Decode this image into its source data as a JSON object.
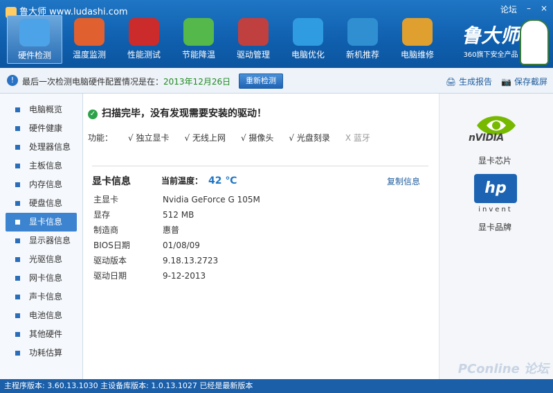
{
  "app": {
    "title": "鲁大师 www.ludashi.com",
    "forum": "论坛"
  },
  "window": {
    "minimize": "–",
    "close": "×"
  },
  "toolbar": [
    {
      "label": "硬件检测",
      "active": true,
      "color": "#4da3e8"
    },
    {
      "label": "温度监测",
      "active": false,
      "color": "#e06030"
    },
    {
      "label": "性能测试",
      "active": false,
      "color": "#cc2b2b"
    },
    {
      "label": "节能降温",
      "active": false,
      "color": "#55b84a"
    },
    {
      "label": "驱动管理",
      "active": false,
      "color": "#c04040"
    },
    {
      "label": "电脑优化",
      "active": false,
      "color": "#2f9be0"
    },
    {
      "label": "新机推荐",
      "active": false,
      "color": "#2f8fd0"
    },
    {
      "label": "电脑维修",
      "active": false,
      "color": "#e0a030"
    }
  ],
  "brand": {
    "name": "鲁大师",
    "slogan": "360旗下安全产品"
  },
  "infobar": {
    "message": "最后一次检测电脑硬件配置情况是在：",
    "date": "2013年12月26日",
    "recheck": "重新检测",
    "report": "生成报告",
    "screenshot": "保存截屏"
  },
  "sidebar": {
    "items": [
      {
        "label": "电脑概览",
        "active": false
      },
      {
        "label": "硬件健康",
        "active": false
      },
      {
        "label": "处理器信息",
        "active": false
      },
      {
        "label": "主板信息",
        "active": false
      },
      {
        "label": "内存信息",
        "active": false
      },
      {
        "label": "硬盘信息",
        "active": false
      },
      {
        "label": "显卡信息",
        "active": true
      },
      {
        "label": "显示器信息",
        "active": false
      },
      {
        "label": "光驱信息",
        "active": false
      },
      {
        "label": "网卡信息",
        "active": false
      },
      {
        "label": "声卡信息",
        "active": false
      },
      {
        "label": "电池信息",
        "active": false
      },
      {
        "label": "其他硬件",
        "active": false
      },
      {
        "label": "功耗估算",
        "active": false
      }
    ]
  },
  "main": {
    "scan_result": "扫描完毕，没有发现需要安装的驱动！",
    "features_label": "功能：",
    "features": [
      {
        "text": "√ 独立显卡",
        "enabled": true
      },
      {
        "text": "√ 无线上网",
        "enabled": true
      },
      {
        "text": "√ 摄像头",
        "enabled": true
      },
      {
        "text": "√ 光盘刻录",
        "enabled": true
      },
      {
        "text": "X 蓝牙",
        "enabled": false
      }
    ],
    "gpu_title": "显卡信息",
    "temp_label": "当前温度：",
    "temp_value": "42 ℃",
    "copy": "复制信息",
    "rows": [
      {
        "k": "主显卡",
        "v": "Nvidia GeForce G 105M"
      },
      {
        "k": "显存",
        "v": "512 MB"
      },
      {
        "k": "制造商",
        "v": "惠普"
      },
      {
        "k": "BIOS日期",
        "v": "01/08/09"
      },
      {
        "k": "驱动版本",
        "v": "9.18.13.2723"
      },
      {
        "k": "驱动日期",
        "v": "9-12-2013"
      }
    ]
  },
  "right": {
    "chip_logo": "nVIDIA",
    "chip_caption": "显卡芯片",
    "brand_logo": "hp",
    "brand_logo_sub": "invent",
    "brand_caption": "显卡品牌"
  },
  "status": {
    "text": "主程序版本: 3.60.13.1030  主设备库版本: 1.0.13.1027  已经是最新版本"
  },
  "watermark": "PConline 论坛"
}
